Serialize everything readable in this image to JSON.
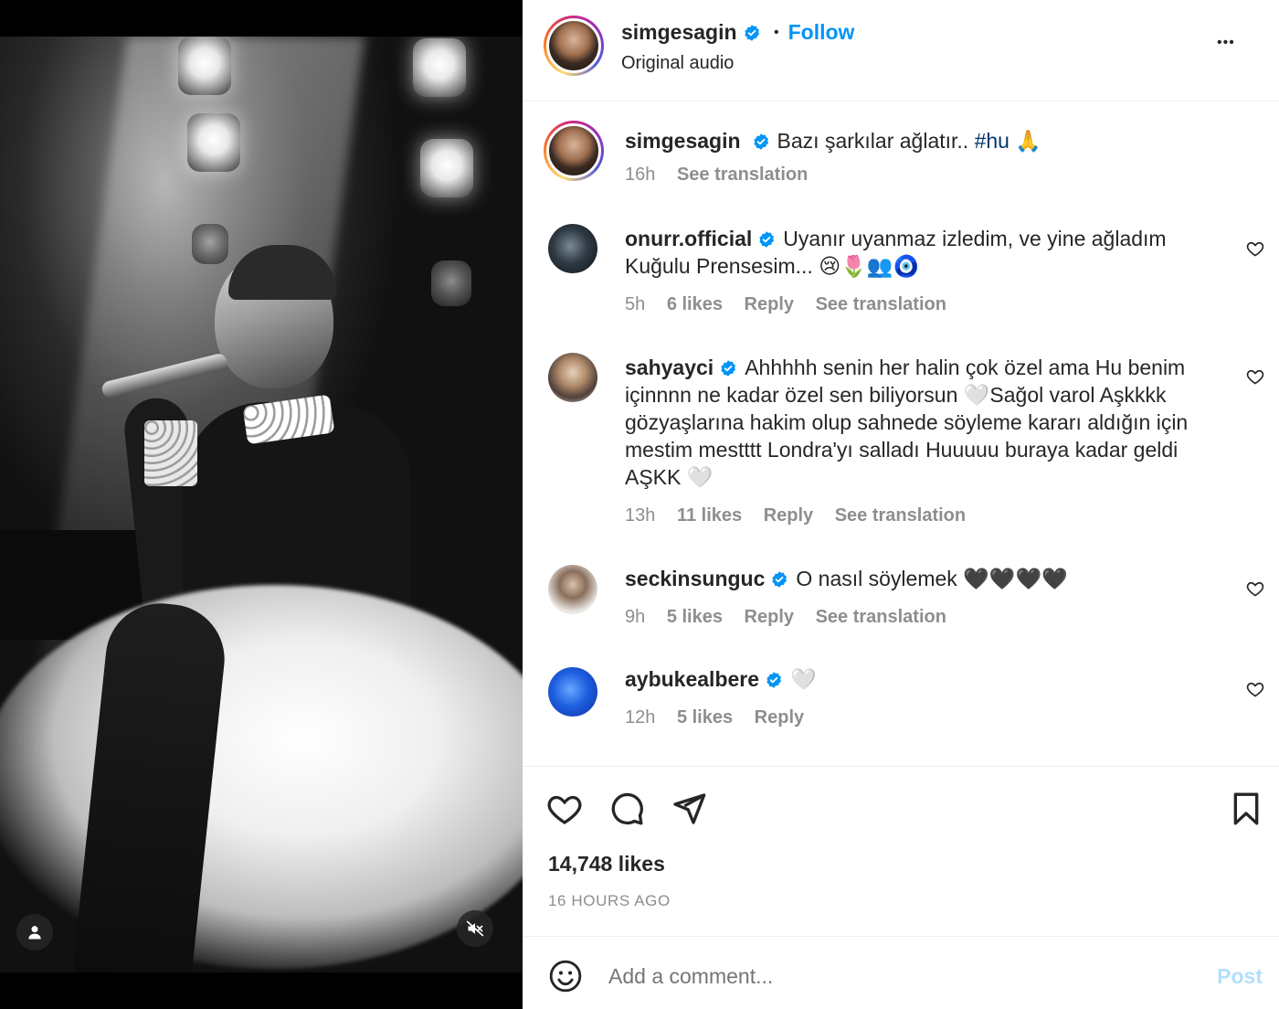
{
  "post": {
    "author": "simgesagin",
    "follow_label": "Follow",
    "separator": "•",
    "audio": "Original audio",
    "more_label": "•••",
    "caption": {
      "username": "simgesagin",
      "text": "Bazı şarkılar ağlatır.. ",
      "hashtag": "#hu",
      "emoji": "🙏",
      "time": "16h",
      "see_translation": "See translation"
    },
    "comments": [
      {
        "username": "onurr.official",
        "text": "Uyanır uyanmaz izledim, ve yine ağladım Kuğulu Prensesim... 😢🌷👥🧿",
        "time": "5h",
        "likes": "6 likes",
        "reply": "Reply",
        "see_translation": "See translation"
      },
      {
        "username": "sahyayci",
        "text": "Ahhhhh senin her halin çok özel ama Hu benim içinnnn ne kadar özel sen biliyorsun 🤍Sağol varol Aşkkkk gözyaşlarına hakim olup sahnede söyleme kararı aldığın için mestim mestttt Londra'yı salladı Huuuuu buraya kadar geldi AŞKK 🤍",
        "time": "13h",
        "likes": "11 likes",
        "reply": "Reply",
        "see_translation": "See translation"
      },
      {
        "username": "seckinsunguc",
        "text": "O nasıl söylemek 🖤🖤🖤🖤",
        "time": "9h",
        "likes": "5 likes",
        "reply": "Reply",
        "see_translation": "See translation"
      },
      {
        "username": "aybukealbere",
        "text": "🤍",
        "time": "12h",
        "likes": "5 likes",
        "reply": "Reply",
        "see_translation": ""
      }
    ],
    "likes_count": "14,748 likes",
    "posted_ago": "16 HOURS AGO",
    "add_comment_placeholder": "Add a comment...",
    "post_button": "Post"
  },
  "colors": {
    "accent": "#0095f6",
    "muted": "#8e8e8e",
    "text": "#262626",
    "post_disabled": "#b2dffc"
  }
}
